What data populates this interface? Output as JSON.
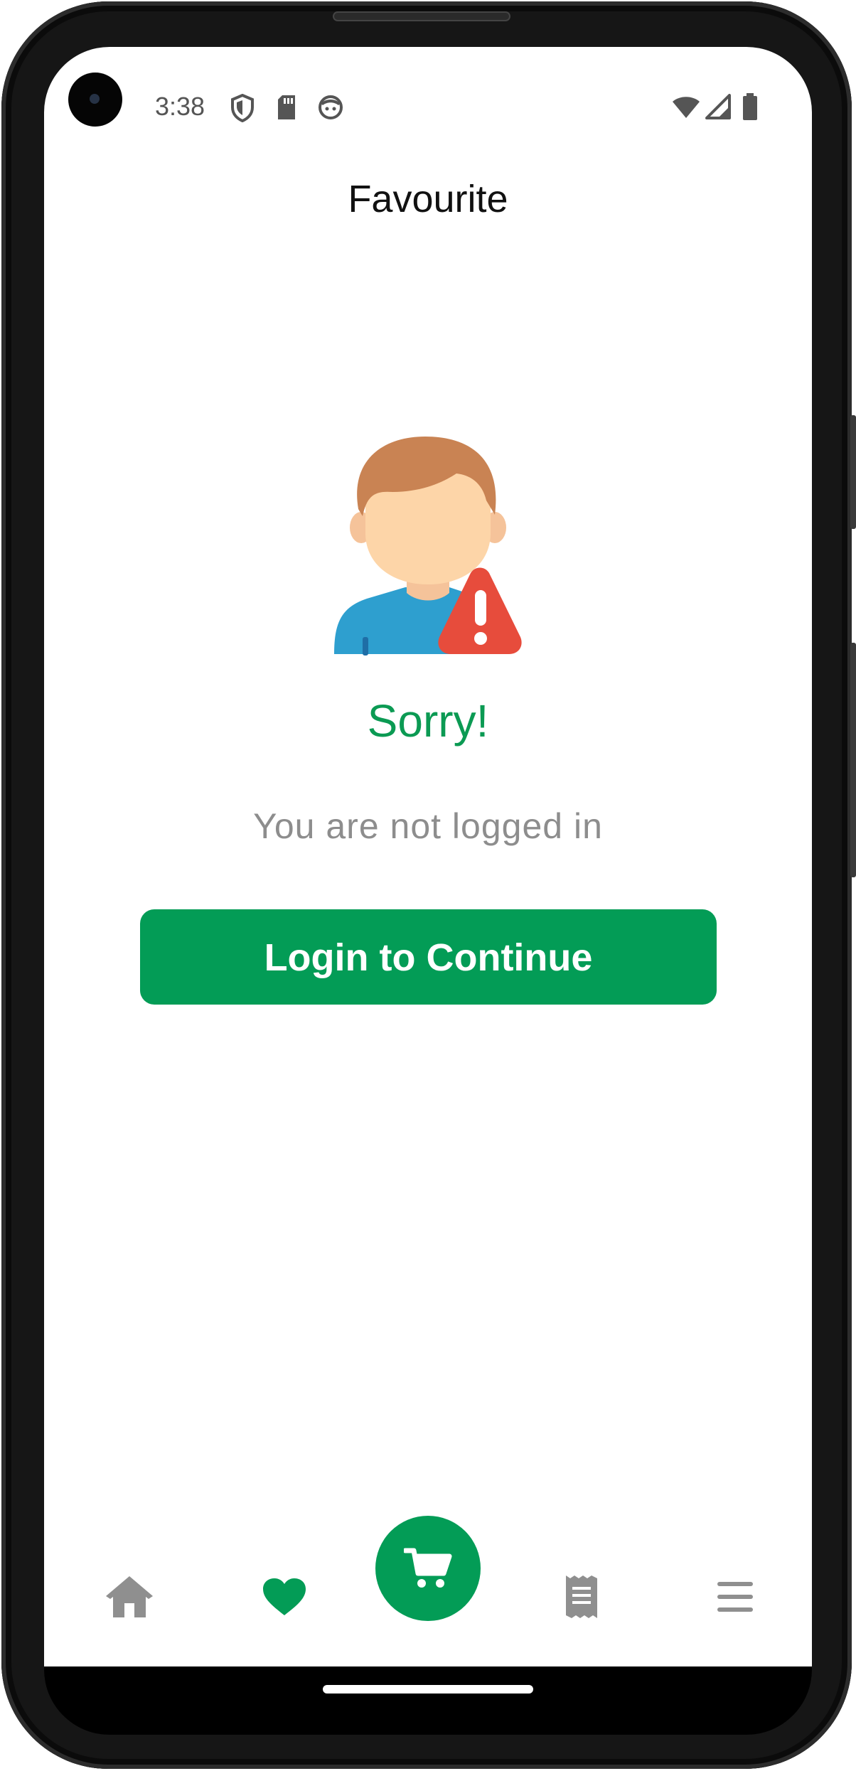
{
  "status_bar": {
    "time": "3:38"
  },
  "header": {
    "title": "Favourite"
  },
  "message": {
    "title": "Sorry!",
    "subtitle": "You are not logged in"
  },
  "actions": {
    "login_label": "Login to Continue"
  },
  "bottom_nav": {
    "active": "favourite",
    "items": [
      {
        "icon": "home-icon"
      },
      {
        "icon": "heart-icon"
      },
      {
        "icon": "cart-icon"
      },
      {
        "icon": "receipt-icon"
      },
      {
        "icon": "menu-icon"
      }
    ]
  },
  "colors": {
    "brand_green": "#039c56",
    "inactive_icon": "#8f8f8f",
    "alert_red": "#e74c3c"
  }
}
